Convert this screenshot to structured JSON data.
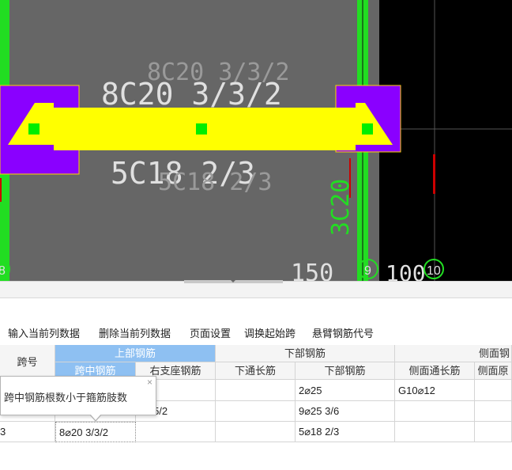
{
  "canvas": {
    "labels": {
      "top_label_ghost": "8C20 3/3/2",
      "top_label": "8C20 3/3/2",
      "bottom_label": "5C18 2/3",
      "bottom_label_ghost": "5C18 2/3",
      "vertical_label": "3C20",
      "dim_150": "150",
      "dim_100": "100",
      "axis_8": "8",
      "axis_9": "9",
      "axis_10": "10"
    },
    "colors": {
      "background": "#000000",
      "slab": "#666666",
      "column": "#22dd22",
      "support": "#8a00ff",
      "beam": "#ffff00",
      "grip": "#00ee00",
      "marker": "#cc0000"
    }
  },
  "toolbar": {
    "items": [
      "输入当前列数据",
      "删除当前列数据",
      "页面设置",
      "调换起始跨",
      "悬臂钢筋代号"
    ]
  },
  "grid": {
    "header": {
      "span_no": "跨号",
      "top_rebar": "上部钢筋",
      "bottom_rebar": "下部钢筋",
      "side_rebar": "侧面钢",
      "mid_span": "跨中钢筋",
      "right_support": "右支座钢筋",
      "bottom_through": "下通长筋",
      "bottom_rebar_col": "下部钢筋",
      "side_through": "侧面通长筋",
      "side_col": "侧面原"
    },
    "rows": [
      {
        "span_no": "",
        "mid_span": "",
        "right_support": "",
        "bottom_through": "",
        "bottom_rebar": "2⌀25",
        "side_through": "G10⌀12",
        "side_col": ""
      },
      {
        "span_no": "",
        "mid_span": "",
        "right_support": "25 5/2",
        "bottom_through": "",
        "bottom_rebar": "9⌀25 3/6",
        "side_through": "",
        "side_col": ""
      },
      {
        "span_no": "3",
        "mid_span": "8⌀20 3/3/2",
        "right_support": "",
        "bottom_through": "",
        "bottom_rebar": "5⌀18 2/3",
        "side_through": "",
        "side_col": ""
      }
    ]
  },
  "tooltip": {
    "message": "跨中钢筋根数小于箍筋肢数",
    "close": "×"
  }
}
